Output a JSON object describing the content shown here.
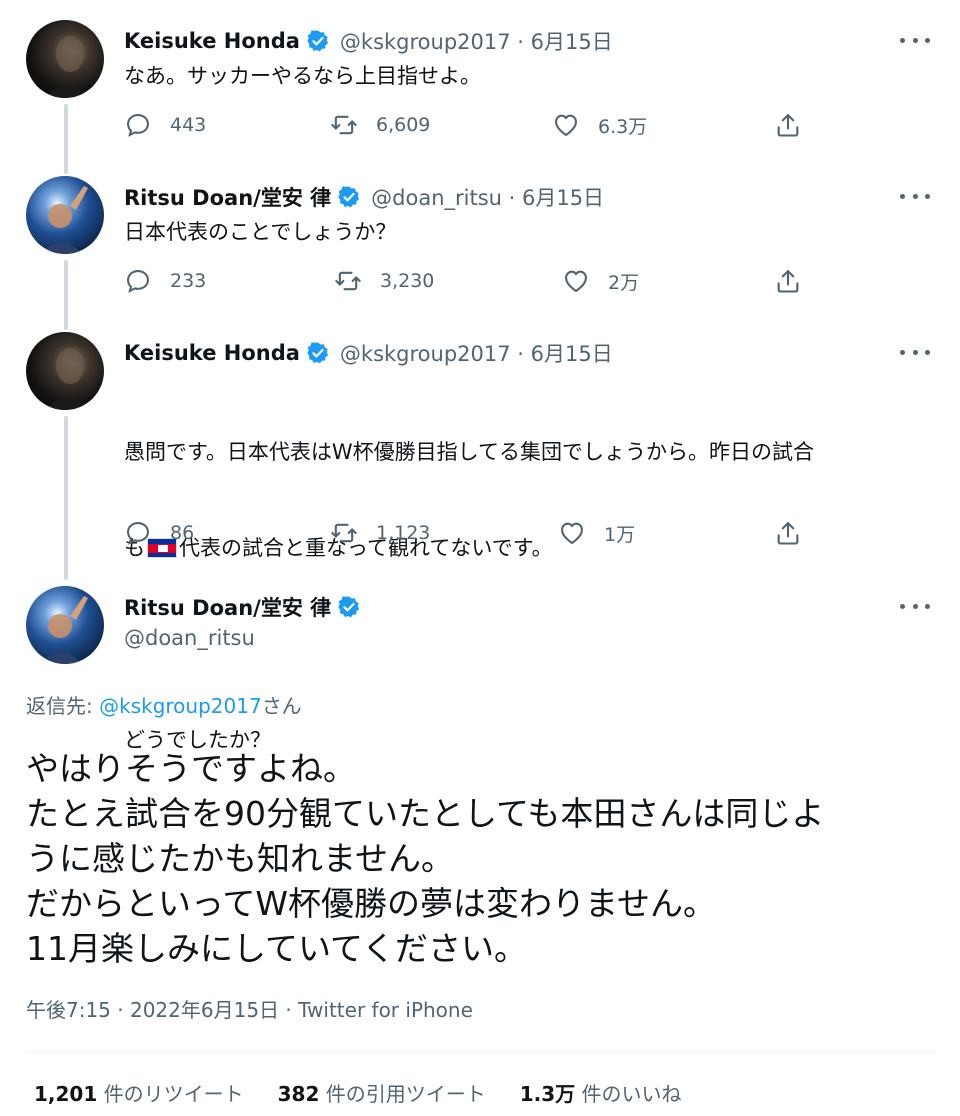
{
  "tweets": [
    {
      "name": "Keisuke Honda",
      "handle_meta": "@kskgroup2017 · 6月15日",
      "text": "なあ。サッカーやるなら上目指せよ。",
      "replies": "443",
      "retweets": "6,609",
      "likes": "6.3万"
    },
    {
      "name": "Ritsu Doan/堂安 律",
      "handle_meta": "@doan_ritsu · 6月15日",
      "text": "日本代表のことでしょうか？",
      "replies": "233",
      "retweets": "3,230",
      "likes": "2万"
    },
    {
      "name": "Keisuke Honda",
      "handle_meta": "@kskgroup2017 · 6月15日",
      "text_a": "愚問です。日本代表はW杯優勝目指してる集団でしょうから。昨日の試合",
      "text_b_prefix": "も",
      "text_b_suffix": "代表の試合と重なって観れてないです。",
      "text_c": "どうでしたか？",
      "replies": "86",
      "retweets": "1,123",
      "likes": "1万"
    }
  ],
  "main_tweet": {
    "name": "Ritsu Doan/堂安 律",
    "handle": "@doan_ritsu",
    "reply_to_label": "返信先: ",
    "reply_to_handle": "@kskgroup2017",
    "reply_to_suffix": "さん",
    "text": "やはりそうですよね。\nたとえ試合を90分観ていたとしても本田さんは同じよ\nうに感じたかも知れません。\nだからといってW杯優勝の夢は変わりません。\n11月楽しみにしていてください。",
    "timestamp": "午後7:15 · 2022年6月15日 · ",
    "source": "Twitter for iPhone",
    "stats": {
      "retweets_count": "1,201",
      "retweets_label": " 件のリツイート",
      "quotes_count": "382",
      "quotes_label": " 件の引用ツイート",
      "likes_count": "1.3万",
      "likes_label": " 件のいいね"
    }
  },
  "icons": {
    "reply": "reply-icon",
    "retweet": "retweet-icon",
    "like": "heart-icon",
    "share": "share-icon",
    "verified": "verified-badge-icon",
    "more": "more-icon"
  },
  "colors": {
    "text_primary": "#0f1419",
    "text_secondary": "#536471",
    "link": "#1d9bf0",
    "verified": "#1d9bf0",
    "thread_line": "#cfd9de"
  }
}
